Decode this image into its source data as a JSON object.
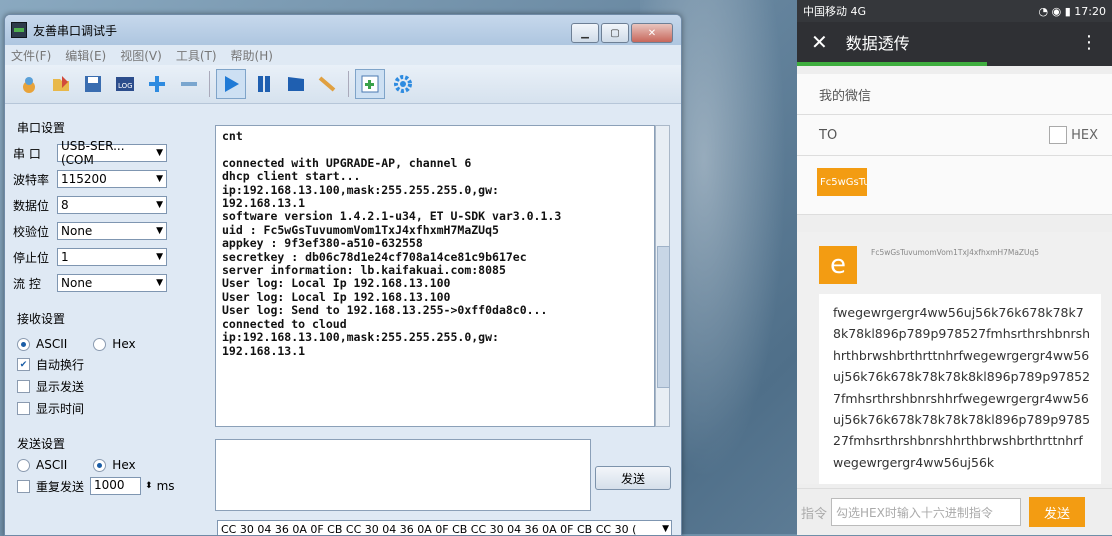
{
  "window": {
    "title": "友善串口调试手",
    "menus": [
      "文件(F)",
      "编辑(E)",
      "视图(V)",
      "工具(T)",
      "帮助(H)"
    ]
  },
  "serial_settings": {
    "title": "串口设置",
    "port_label": "串  口",
    "port_value": "USB-SER...(COM",
    "baud_label": "波特率",
    "baud_value": "115200",
    "databits_label": "数据位",
    "databits_value": "8",
    "parity_label": "校验位",
    "parity_value": "None",
    "stopbits_label": "停止位",
    "stopbits_value": "1",
    "flow_label": "流  控",
    "flow_value": "None"
  },
  "receive_settings": {
    "title": "接收设置",
    "ascii_label": "ASCII",
    "hex_label": "Hex",
    "autowrap_label": "自动换行",
    "showsend_label": "显示发送",
    "showtime_label": "显示时间"
  },
  "send_settings": {
    "title": "发送设置",
    "ascii_label": "ASCII",
    "hex_label": "Hex",
    "repeat_label": "重复发送",
    "repeat_value": "1000",
    "unit": "ms"
  },
  "terminal": {
    "text": "cnt\n\nconnected with UPGRADE-AP, channel 6\ndhcp client start...\nip:192.168.13.100,mask:255.255.255.0,gw:\n192.168.13.1\nsoftware version 1.4.2.1-u34, ET U-SDK var3.0.1.3\nuid : Fc5wGsTuvumomVom1TxJ4xfhxmH7MaZUq5\nappkey : 9f3ef380-a510-632558\nsecretkey : db06c78d1e24cf708a14ce81c9b617ec\nserver information: lb.kaifakuai.com:8085\nUser log: Local Ip 192.168.13.100\nUser log: Local Ip 192.168.13.100\nUser log: Send to 192.168.13.255->0xff0da8c0...\nconnected to cloud\nip:192.168.13.100,mask:255.255.255.0,gw:\n192.168.13.1"
  },
  "send_button": "发送",
  "hex_history": "CC 30 04 36 0A 0F CB CC 30 04 36 0A 0F CB CC 30 04 36 0A 0F CB CC 30 (",
  "phone": {
    "carrier": "中国移动 4G",
    "time": "17:20",
    "header_title": "数据透传",
    "my_wechat": "我的微信",
    "to_label": "TO",
    "hex_label": "HEX",
    "to_tag": "Fc5wGsTu",
    "avatar_letter": "e",
    "sender_id": "Fc5wGsTuvumomVom1TxJ4xfhxmH7MaZUq5",
    "message": "fwegewrgergr4ww56uj56k76k678k78k78k78kl896p789p978527fmhsrthrshbnrshhrthbrwshbrthrttnhrfwegewrgergr4ww56uj56k76k678k78k78k8kl896p789p978527fmhsrthrshbnrshhrfwegewrgergr4ww56uj56k76k678k78k78k78kl896p789p978527fmhsrthrshbnrshhrthbrwshbrthrttnhrfwegewrgergr4ww56uj56k",
    "cmd_label": "指令",
    "input_placeholder": "勾选HEX时输入十六进制指令",
    "send_label": "发送"
  }
}
